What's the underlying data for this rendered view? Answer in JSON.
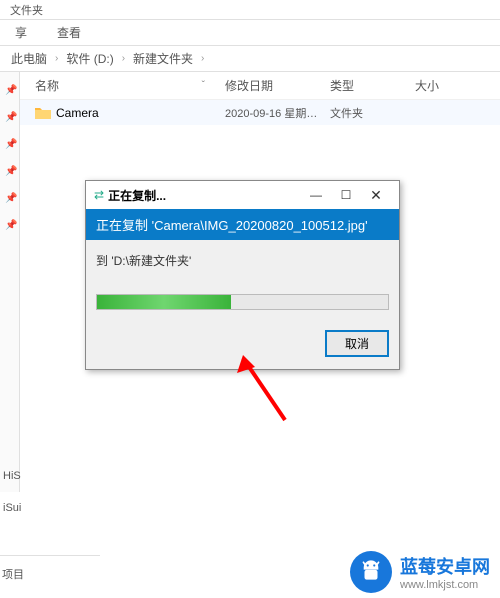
{
  "tab": {
    "label": "文件夹"
  },
  "toolbar": {
    "item1": "享",
    "item2": "查看"
  },
  "breadcrumb": {
    "p1": "此电脑",
    "p2": "软件 (D:)",
    "p3": "新建文件夹"
  },
  "columns": {
    "name": "名称",
    "date": "修改日期",
    "type": "类型",
    "size": "大小"
  },
  "row": {
    "name": "Camera",
    "date": "2020-09-16 星期…",
    "type": "文件夹"
  },
  "side_items": {
    "a": "HiS",
    "b": "iSui",
    "c": "项目"
  },
  "dialog": {
    "title": "正在复制...",
    "banner": "正在复制 'Camera\\IMG_20200820_100512.jpg'",
    "dest": "到 'D:\\新建文件夹'",
    "cancel": "取消",
    "progress_pct": 46
  },
  "watermark": {
    "line1": "蓝莓安卓网",
    "line2": "www.lmkjst.com"
  }
}
